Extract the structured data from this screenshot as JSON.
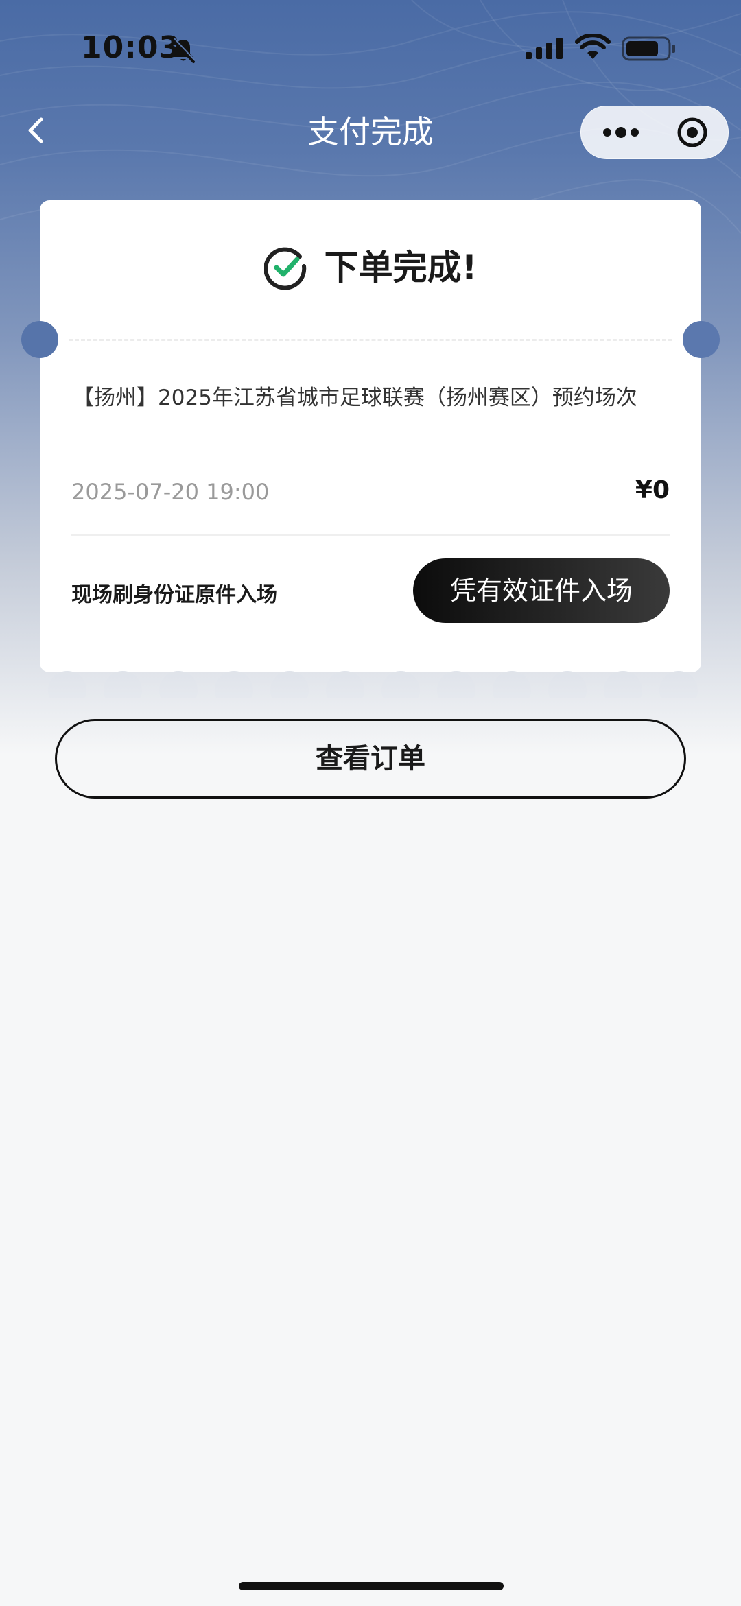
{
  "status_bar": {
    "time": "10:03",
    "icons": [
      "bell-muted-icon",
      "signal-icon",
      "wifi-icon",
      "battery-icon"
    ]
  },
  "nav": {
    "title": "支付完成",
    "back_icon": "chevron-left-icon",
    "capsule_icons": [
      "more-dots-icon",
      "close-target-icon"
    ]
  },
  "ticket": {
    "status_text": "下单完成!",
    "status_icon": "check-circle-icon",
    "event_title": "【扬州】2025年江苏省城市足球联赛（扬州赛区）预约场次",
    "event_time": "2025-07-20 19:00",
    "price": "¥0",
    "entry_note": "现场刷身份证原件入场",
    "entry_button": "凭有效证件入场"
  },
  "actions": {
    "view_order": "查看订单"
  },
  "colors": {
    "hero_top": "#4a6ba5",
    "check_green": "#21b26b",
    "pill_dark": "#0c0c0c"
  }
}
